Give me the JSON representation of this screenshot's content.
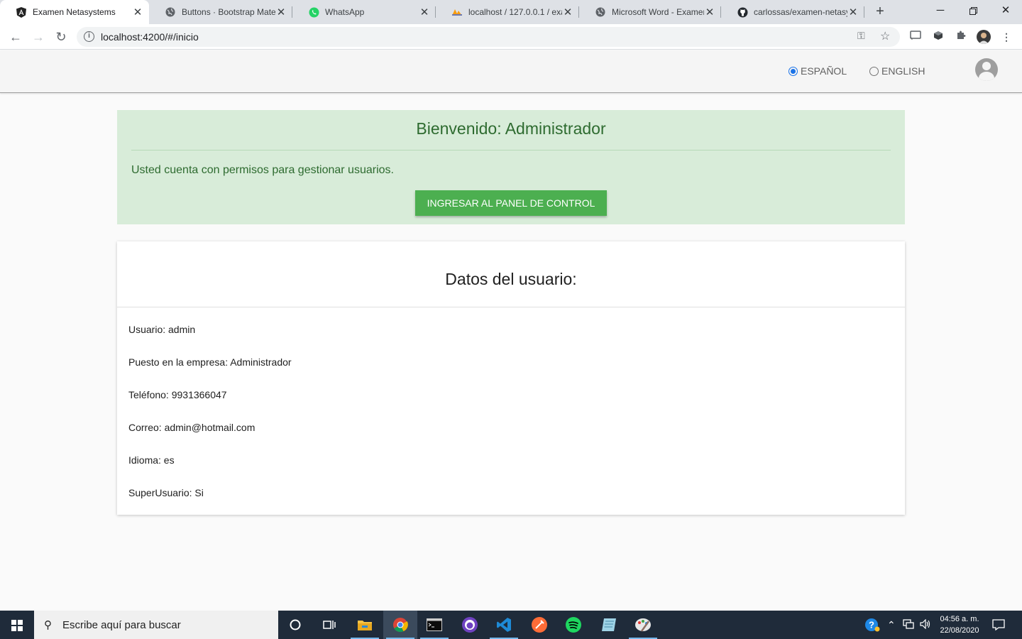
{
  "browser": {
    "tabs": [
      {
        "title": "Examen Netasystems",
        "icon": "angular-icon",
        "active": true
      },
      {
        "title": "Buttons · Bootstrap Mater",
        "icon": "globe-icon",
        "active": false
      },
      {
        "title": "WhatsApp",
        "icon": "whatsapp-icon",
        "active": false
      },
      {
        "title": "localhost / 127.0.0.1 / exa",
        "icon": "phpmyadmin-icon",
        "active": false
      },
      {
        "title": "Microsoft Word - Examen",
        "icon": "globe-icon",
        "active": false
      },
      {
        "title": "carlossas/examen-netasys",
        "icon": "github-icon",
        "active": false
      }
    ],
    "url": "localhost:4200/#/inicio"
  },
  "header": {
    "languages": [
      {
        "label": "ESPAÑOL",
        "selected": true
      },
      {
        "label": "ENGLISH",
        "selected": false
      }
    ]
  },
  "welcome": {
    "title": "Bienvenido: Administrador",
    "message": "Usted cuenta con permisos para gestionar usuarios.",
    "button": "INGRESAR AL PANEL DE CONTROL"
  },
  "user_card": {
    "title": "Datos del usuario:",
    "fields": [
      "Usuario: admin",
      "Puesto en la empresa: Administrador",
      "Teléfono: 9931366047",
      "Correo: admin@hotmail.com",
      "Idioma: es",
      "SuperUsuario: Si"
    ]
  },
  "taskbar": {
    "search_placeholder": "Escribe aquí para buscar",
    "time": "04:56 a. m.",
    "date": "22/08/2020"
  },
  "colors": {
    "alert_bg": "#d8ecd9",
    "alert_text": "#2e6b30",
    "button_green": "#4caf50",
    "radio_accent": "#1a73e8"
  }
}
